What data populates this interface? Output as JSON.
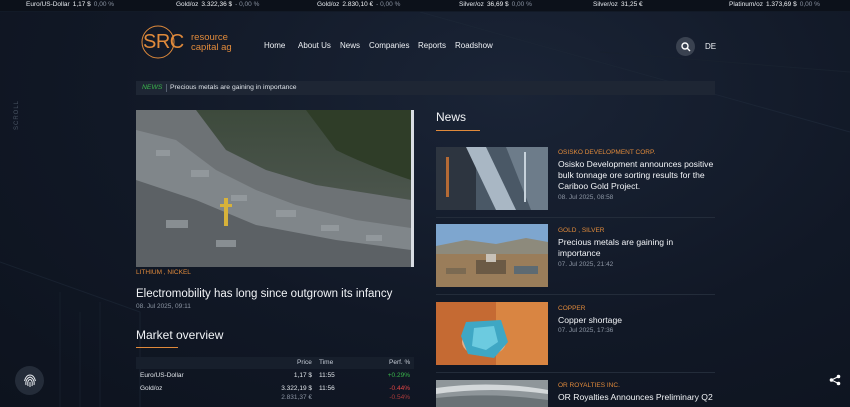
{
  "ticker": [
    {
      "name": "Euro/US-Dollar",
      "value": "1,17 $",
      "change": "0,00 %"
    },
    {
      "name": "Gold/oz",
      "value": "3.322,36 $",
      "change": "- 0,00 %"
    },
    {
      "name": "Gold/oz",
      "value": "2.830,10 €",
      "change": "- 0,00 %"
    },
    {
      "name": "Silver/oz",
      "value": "36,69 $",
      "change": "0,00 %"
    },
    {
      "name": "Silver/oz",
      "value": "31,25 €",
      "change": ""
    },
    {
      "name": "Platinum/oz",
      "value": "1.373,69 $",
      "change": "0,00 %"
    }
  ],
  "logo": {
    "mark": "SRC",
    "line1": "resource",
    "line2": "capital ag"
  },
  "nav": [
    "Home",
    "About Us",
    "News",
    "Companies",
    "Reports",
    "Roadshow"
  ],
  "lang": "DE",
  "strip": {
    "tag": "NEWS",
    "text": "Precious metals are gaining in importance"
  },
  "scroll_label": "SCROLL",
  "featured": {
    "category": "LITHIUM , NICKEL",
    "title": "Electromobility has long since outgrown its infancy",
    "date": "08. Jul 2025, 09:11"
  },
  "market": {
    "title": "Market overview",
    "headers": {
      "price": "Price",
      "time": "Time",
      "perf": "Perf. %"
    },
    "rows": [
      {
        "name": "Euro/US-Dollar",
        "price": "1,17 $",
        "price2": "",
        "time": "11:55",
        "perf": "+0.29%",
        "perf2": "",
        "perf_color": "#39b54a"
      },
      {
        "name": "Gold/oz",
        "price": "3.322,19 $",
        "price2": "2.831,37 €",
        "time": "11:56",
        "perf": "-0.44%",
        "perf2": "-0.54%",
        "perf_color": "#e04545"
      }
    ]
  },
  "news": {
    "title": "News",
    "items": [
      {
        "category": "OSISKO DEVELOPMENT CORP.",
        "headline": "Osisko Development announces positive bulk tonnage ore sorting results for the Cariboo Gold Project.",
        "date": "08. Jul 2025, 08:58"
      },
      {
        "category": "GOLD , SILVER",
        "headline": "Precious metals are gaining in importance",
        "date": "07. Jul 2025, 21:42"
      },
      {
        "category": "COPPER",
        "headline": "Copper shortage",
        "date": "07. Jul 2025, 17:36"
      },
      {
        "category": "OR ROYALTIES INC.",
        "headline": "OR Royalties Announces Preliminary Q2",
        "date": ""
      }
    ]
  },
  "colors": {
    "accent": "#e08a3b",
    "positive": "#39b54a",
    "negative": "#e04545",
    "background": "#121a27"
  },
  "icons": {
    "search": "search-icon",
    "fingerprint": "fingerprint-icon",
    "share": "share-icon"
  }
}
